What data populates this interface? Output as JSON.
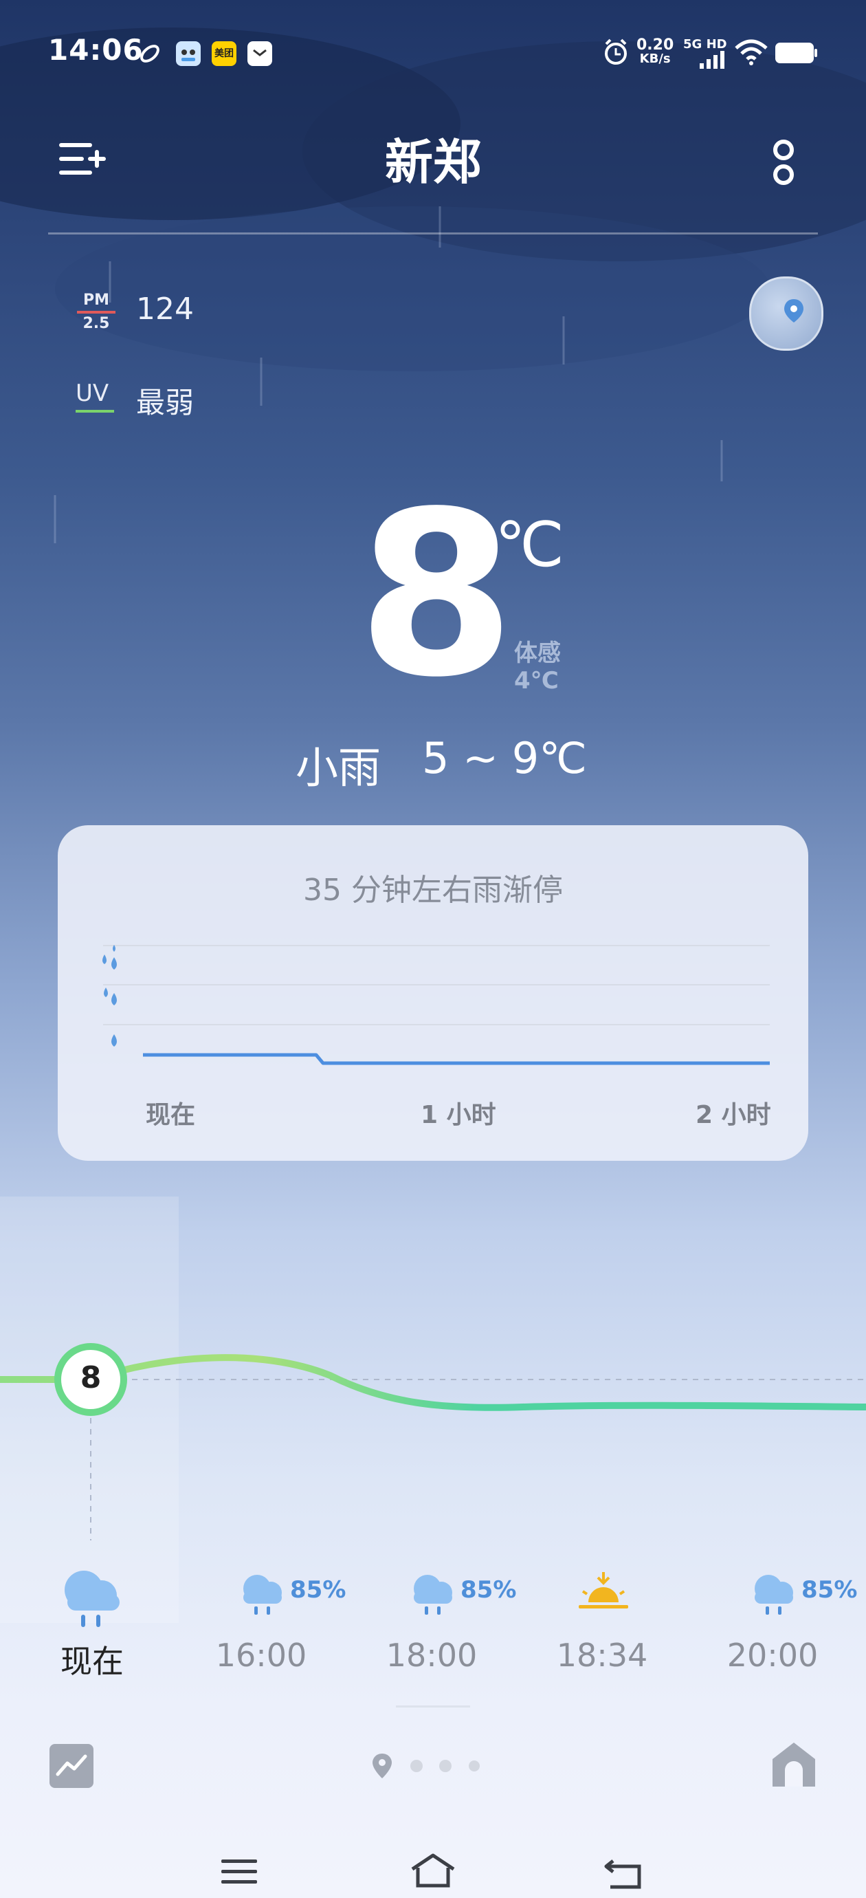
{
  "status_bar": {
    "time": "14:06",
    "net_speed_value": "0.20",
    "net_speed_unit": "KB/s",
    "network_gen": "5G HD",
    "app_icons": [
      "pill-app-icon",
      "cartoon-app-icon",
      "meituan-icon",
      "mail-icon"
    ],
    "meituan_label": "美团"
  },
  "header": {
    "city": "新郑"
  },
  "air": {
    "pm_top": "PM",
    "pm_bottom": "2.5",
    "pm_value": "124",
    "uv_label": "UV",
    "uv_value": "最弱"
  },
  "current": {
    "temperature": "8",
    "unit": "℃",
    "feels_like_label": "体感",
    "feels_like_value": "4℃",
    "condition": "小雨",
    "range": "5 ~ 9℃"
  },
  "rain_card": {
    "title": "35 分钟左右雨渐停",
    "x_labels": [
      "现在",
      "1 小时",
      "2 小时"
    ],
    "chart_data": {
      "type": "line",
      "x_minutes": [
        0,
        35,
        120
      ],
      "intensity_level": [
        0.25,
        0.05,
        0.05
      ],
      "levels": [
        "light",
        "moderate",
        "heavy"
      ]
    }
  },
  "temp_curve": {
    "current_marker": "8",
    "line_color": "#4fd3a0"
  },
  "hourly": [
    {
      "time": "现在",
      "icon": "rain-cloud-icon",
      "precip": ""
    },
    {
      "time": "16:00",
      "icon": "rain-cloud-icon",
      "precip": "85%"
    },
    {
      "time": "18:00",
      "icon": "rain-cloud-icon",
      "precip": "85%"
    },
    {
      "time": "18:34",
      "icon": "sunset-icon",
      "precip": ""
    },
    {
      "time": "20:00",
      "icon": "rain-cloud-icon",
      "precip": "85%"
    }
  ],
  "colors": {
    "accent_blue": "#4f8fd9",
    "temp_green": "#4fd3a0",
    "sunset_yellow": "#f2b51f"
  }
}
